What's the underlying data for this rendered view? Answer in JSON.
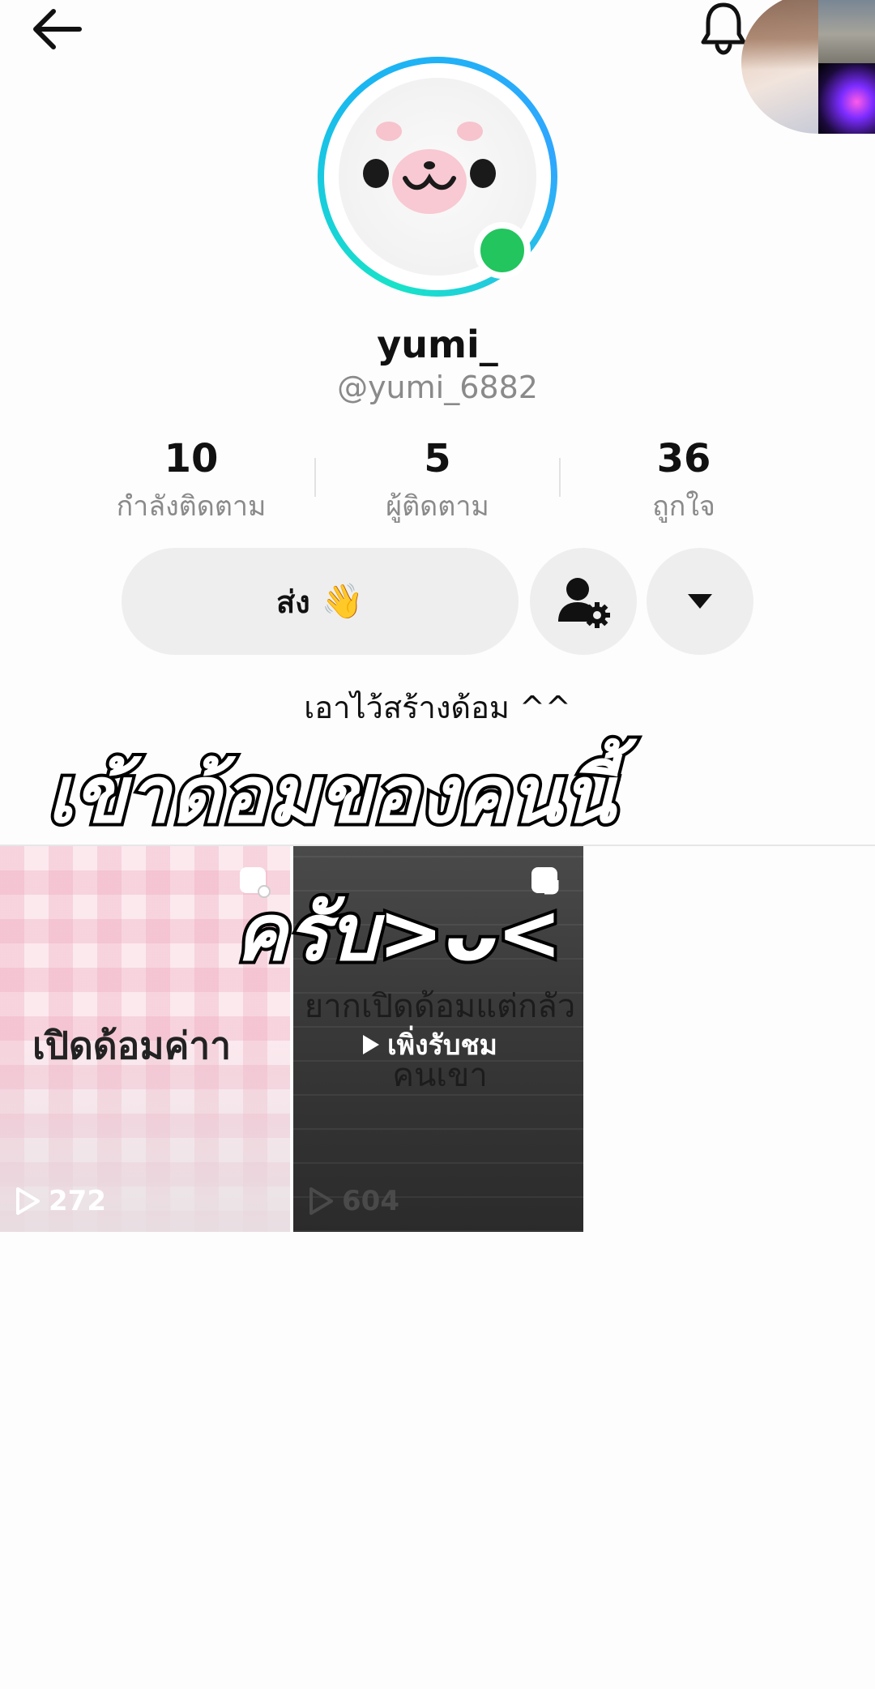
{
  "profile": {
    "display_name": "yumi_",
    "username": "@yumi_6882",
    "bio": "เอาไว้สร้างด้อม ^^"
  },
  "stats": [
    {
      "value": "10",
      "label": "กำลังติดตาม"
    },
    {
      "value": "5",
      "label": "ผู้ติดตาม"
    },
    {
      "value": "36",
      "label": "ถูกใจ"
    }
  ],
  "actions": {
    "send_label": "ส่ง",
    "send_emoji": "👋"
  },
  "overlay": {
    "line1": "เข้าด้อมของคนนี้",
    "line2": "ครับ>ᴗ<"
  },
  "videos": [
    {
      "title": "เปิดด้อมค่าา",
      "views": "272"
    },
    {
      "bg_line1": "ยากเปิดด้อมแต่กลัว",
      "bg_line2": "คนเขา",
      "badge": "เพิ่งรับชม",
      "views": "604"
    }
  ],
  "icons": {
    "back": "arrow-left-icon",
    "bell": "bell-icon",
    "profile_settings": "user-gear-icon",
    "more": "caret-down-icon",
    "play": "play-outline-icon",
    "pin": "pin-square-icon"
  },
  "colors": {
    "ring_start": "#18e3c8",
    "ring_end": "#2fa6ff",
    "online": "#22c55e",
    "button_bg": "#eeeeee",
    "secondary_text": "#8a8a8a"
  }
}
